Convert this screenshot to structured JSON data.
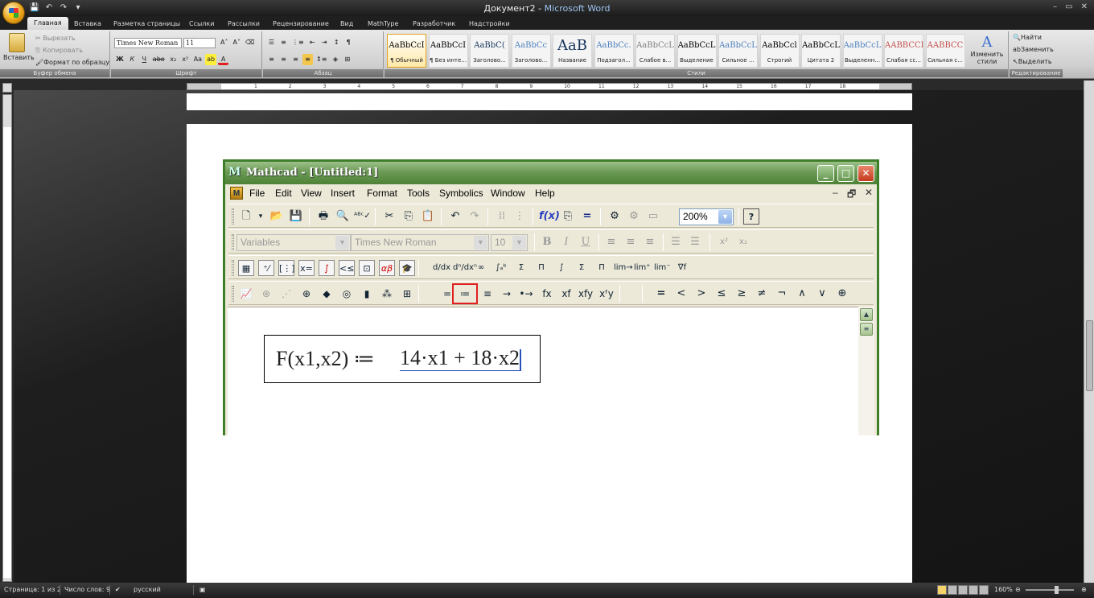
{
  "window": {
    "doc_title": "Документ2",
    "separator": " - ",
    "app_name": "Microsoft Word",
    "controls": [
      "–",
      "▭",
      "✕"
    ]
  },
  "ribbon_tabs": [
    "Главная",
    "Вставка",
    "Разметка страницы",
    "Ссылки",
    "Рассылки",
    "Рецензирование",
    "Вид",
    "MathType",
    "Разработчик",
    "Надстройки"
  ],
  "clipboard": {
    "paste": "Вставить",
    "cut": "Вырезать",
    "copy": "Копировать",
    "format_painter": "Формат по образцу",
    "label": "Буфер обмена"
  },
  "font": {
    "family": "Times New Roman",
    "size": "11",
    "label": "Шрифт",
    "buttons": [
      "Ж",
      "К",
      "Ч",
      "abe",
      "x₂",
      "x²",
      "Aa"
    ]
  },
  "paragraph": {
    "label": "Абзац"
  },
  "styles": {
    "label": "Стили",
    "items": [
      {
        "sample": "AaBbCcI",
        "name": "¶ Обычный",
        "color": "#000000"
      },
      {
        "sample": "AaBbCcI",
        "name": "¶ Без инте...",
        "color": "#000000"
      },
      {
        "sample": "AaBbC(",
        "name": "Заголово...",
        "color": "#17365d"
      },
      {
        "sample": "AaBbCc",
        "name": "Заголово...",
        "color": "#4f81bd"
      },
      {
        "sample": "AaB",
        "name": "Название",
        "color": "#17365d"
      },
      {
        "sample": "AaBbCc.",
        "name": "Подзагол...",
        "color": "#4f81bd"
      },
      {
        "sample": "AaBbCcL",
        "name": "Слабое в...",
        "color": "#808080"
      },
      {
        "sample": "AaBbCcL",
        "name": "Выделение",
        "color": "#000000"
      },
      {
        "sample": "AaBbCcL",
        "name": "Сильное ...",
        "color": "#4f81bd"
      },
      {
        "sample": "AaBbCcl",
        "name": "Строгий",
        "color": "#000000"
      },
      {
        "sample": "AaBbCcL",
        "name": "Цитата 2",
        "color": "#000000"
      },
      {
        "sample": "AaBbCcL",
        "name": "Выделенн...",
        "color": "#4f81bd"
      },
      {
        "sample": "AABBCCI",
        "name": "Слабая сс...",
        "color": "#c0504d"
      },
      {
        "sample": "AABBCC",
        "name": "Сильная с...",
        "color": "#c0504d"
      }
    ],
    "change_styles": "Изменить стили"
  },
  "editing": {
    "find": "Найти",
    "replace": "Заменить",
    "select": "Выделить",
    "label": "Редактирование"
  },
  "ruler_numbers": [
    "1",
    "2",
    "3",
    "4",
    "5",
    "6",
    "7",
    "8",
    "9",
    "10",
    "11",
    "12",
    "13",
    "14",
    "15",
    "16",
    "17",
    "18"
  ],
  "mathcad": {
    "title": "Mathcad - [Untitled:1]",
    "menu": [
      "File",
      "Edit",
      "View",
      "Insert",
      "Format",
      "Tools",
      "Symbolics",
      "Window",
      "Help"
    ],
    "mdi_controls": [
      "–",
      "🗗",
      "✕"
    ],
    "zoom": "200%",
    "style_combo": "Variables",
    "font_combo": "Times New Roman",
    "size_combo": "10",
    "format_buttons": [
      "B",
      "I",
      "U"
    ],
    "evaluation_ops": [
      "=",
      "≔",
      "≡",
      "→",
      "•→",
      "fx",
      "xf",
      "xfy",
      "xᶠy"
    ],
    "boolean_ops": [
      "=",
      "<",
      ">",
      "≤",
      "≥",
      "≠",
      "¬",
      "∧",
      "∨",
      "⊕"
    ],
    "calculus_ops": [
      "d/dx",
      "dⁿ/dxⁿ",
      "∞",
      "∫ₐᵇ",
      "Σ",
      "Π",
      "∫",
      "Σ",
      "Π",
      "lim→",
      "lim⁺",
      "lim⁻",
      "∇f"
    ],
    "palette_icons": [
      "▦",
      "⁺⁄",
      "[⋮]",
      "x=",
      "∫",
      "<≤",
      "⊡",
      "αβ",
      "🎓"
    ],
    "graph_icons": [
      "📈",
      "⊛",
      "⋰",
      "⊕",
      "◆",
      "◎",
      "▮",
      "⁂",
      "⊞"
    ],
    "equation": {
      "lhs": "F(x1,x2) ≔",
      "rhs": "14·x1 + 18·x2"
    }
  },
  "status": {
    "page": "Страница: 1 из 2",
    "words": "Число слов: 9",
    "language": "русский",
    "zoom": "160%"
  }
}
